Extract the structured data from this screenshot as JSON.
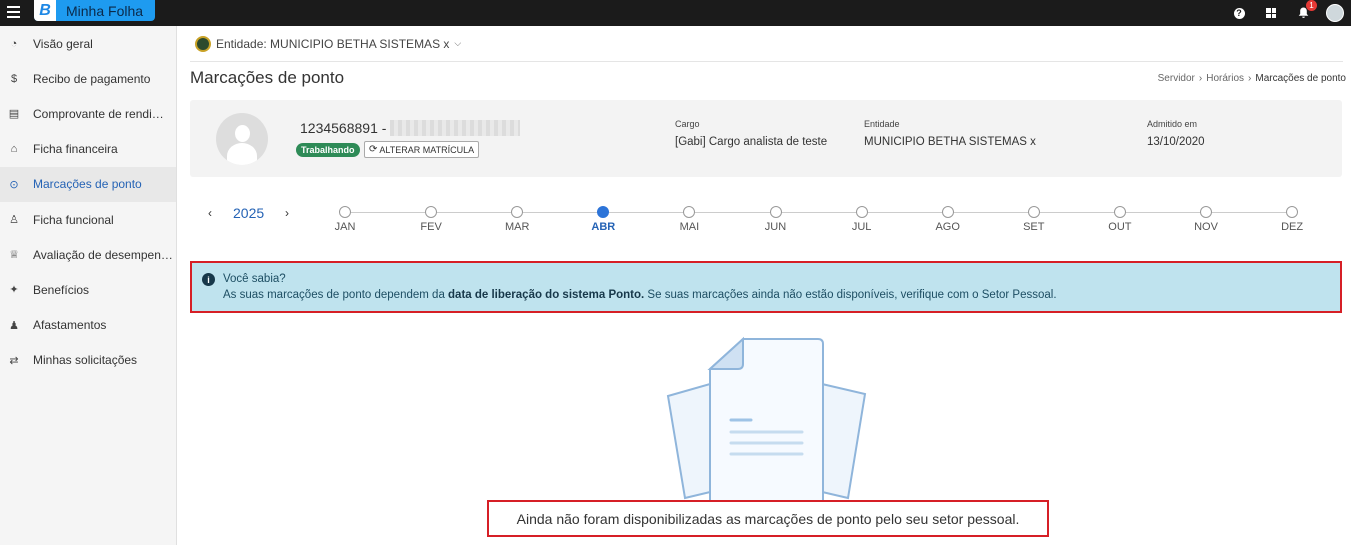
{
  "app": {
    "logo_letter": "B",
    "name": "Minha Folha",
    "notification_count": "1"
  },
  "sidebar": {
    "items": [
      {
        "label": "Visão geral",
        "icon": "pie-chart-icon",
        "active": false
      },
      {
        "label": "Recibo de pagamento",
        "icon": "dollar-icon",
        "active": false
      },
      {
        "label": "Comprovante de rendimentos",
        "icon": "document-icon",
        "active": false
      },
      {
        "label": "Ficha financeira",
        "icon": "bank-icon",
        "active": false
      },
      {
        "label": "Marcações de ponto",
        "icon": "clock-icon",
        "active": true
      },
      {
        "label": "Ficha funcional",
        "icon": "user-icon",
        "active": false
      },
      {
        "label": "Avaliação de desempenho",
        "icon": "trophy-icon",
        "active": false
      },
      {
        "label": "Benefícios",
        "icon": "gift-icon",
        "active": false
      },
      {
        "label": "Afastamentos",
        "icon": "user-x-icon",
        "active": false
      },
      {
        "label": "Minhas solicitações",
        "icon": "exchange-icon",
        "active": false
      }
    ]
  },
  "entity": {
    "label": "Entidade: MUNICIPIO BETHA SISTEMAS x"
  },
  "page": {
    "title": "Marcações de ponto"
  },
  "breadcrumb": [
    "Servidor",
    "Horários",
    "Marcações de ponto"
  ],
  "profile": {
    "matricula": "1234568891 -",
    "status": "Trabalhando",
    "change_button": "ALTERAR MATRÍCULA",
    "cargo_label": "Cargo",
    "cargo_value": "[Gabi] Cargo analista de teste",
    "entidade_label": "Entidade",
    "entidade_value": "MUNICIPIO BETHA SISTEMAS x",
    "admitido_label": "Admitido em",
    "admitido_value": "13/10/2020"
  },
  "timeline": {
    "year": "2025",
    "prev": "‹",
    "next": "›",
    "months": [
      "JAN",
      "FEV",
      "MAR",
      "ABR",
      "MAI",
      "JUN",
      "JUL",
      "AGO",
      "SET",
      "OUT",
      "NOV",
      "DEZ"
    ],
    "selected_month": "ABR"
  },
  "alert": {
    "title": "Você sabia?",
    "text_before": "As suas marcações de ponto dependem da ",
    "text_bold": "data de liberação do sistema Ponto.",
    "text_after": " Se suas marcações ainda não estão disponíveis, verifique com o Setor Pessoal."
  },
  "empty_state": {
    "message": "Ainda não foram disponibilizadas as marcações de ponto pelo seu setor pessoal."
  },
  "colors": {
    "brand": "#1e9bf0",
    "accent": "#2563b5",
    "status_green": "#2e8b57",
    "alert_bg": "#bfe3ee",
    "highlight_red": "#d61f26"
  }
}
